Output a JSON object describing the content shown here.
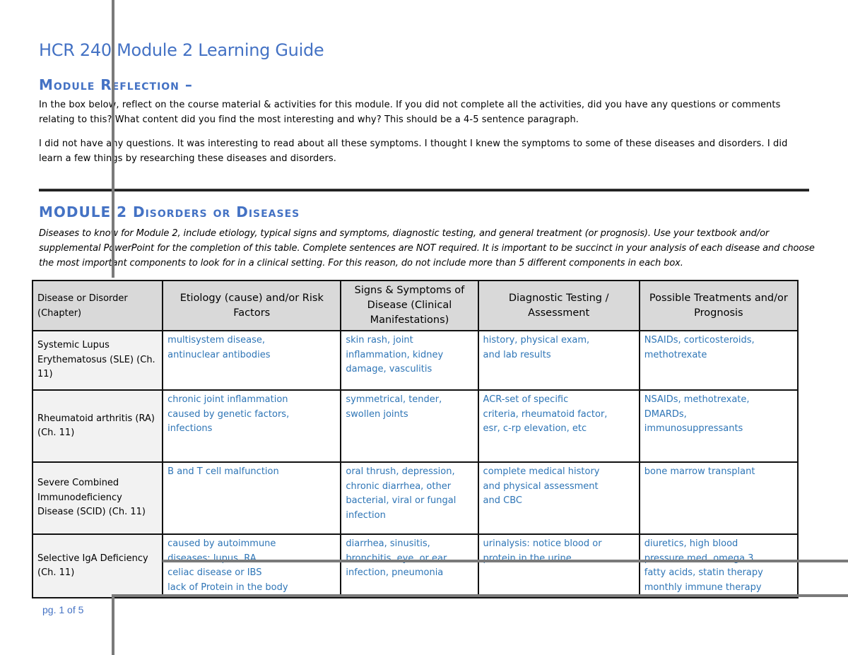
{
  "document": {
    "title": "HCR 240 Module 2 Learning Guide",
    "reflection": {
      "heading": "Module Reflection –",
      "prompt": "In the box below, reflect on the course material & activities for this module.  If you did not complete all the activities, did you have any questions or comments relating to this?  What content did you find the most interesting and why?  This should be a 4-5 sentence paragraph.",
      "answer": "I did not have any questions. It was interesting to read about all these symptoms. I thought I knew the symptoms to some of these diseases and disorders. I did learn a few things by researching these diseases and disorders."
    },
    "module": {
      "heading": "MODULE 2 Disorders or Diseases",
      "instructions": "Diseases to know for Module 2, include etiology, typical signs and symptoms, diagnostic testing, and general treatment (or prognosis).  Use your textbook and/or supplemental PowerPoint for the completion of this table.  Complete sentences are NOT required.   It is important to be succinct in your analysis of each disease and choose the most important components to look for in a clinical setting. For this reason, do not include more than 5 different components in each box."
    },
    "table": {
      "headers": [
        "Disease or Disorder (Chapter)",
        "Etiology (cause) and/or Risk Factors",
        "Signs & Symptoms of Disease (Clinical Manifestations)",
        "Diagnostic Testing / Assessment",
        "Possible Treatments and/or Prognosis"
      ],
      "rows": [
        {
          "disease": "Systemic Lupus Erythematosus (SLE) (Ch. 11)",
          "etiology": "multisystem disease,\nantinuclear antibodies",
          "symptoms": "skin rash, joint\ninflammation, kidney\ndamage, vasculitis",
          "diagnostic": "history, physical exam,\nand lab results",
          "treatment": "NSAIDs, corticosteroids,\nmethotrexate"
        },
        {
          "disease": "Rheumatoid arthritis (RA) (Ch. 11)",
          "etiology": "chronic joint inflammation\ncaused by genetic factors,\ninfections",
          "symptoms": "symmetrical, tender,\nswollen joints",
          "diagnostic": "ACR-set of specific\ncriteria, rheumatoid factor,\nesr, c-rp elevation, etc",
          "treatment": "NSAIDs, methotrexate,\nDMARDs,\nimmunosuppressants"
        },
        {
          "disease": "Severe Combined Immunodeficiency Disease (SCID) (Ch. 11)",
          "etiology": "B and T cell malfunction",
          "symptoms": "oral thrush, depression,\nchronic diarrhea, other\nbacterial, viral or fungal\ninfection",
          "diagnostic": "complete medical history\nand physical assessment\nand CBC",
          "treatment": "bone marrow transplant"
        },
        {
          "disease": "Selective IgA Deficiency (Ch. 11)",
          "etiology": "caused by autoimmune\ndiseases: lupus, RA,\nceliac disease or IBS\nlack of Protein in the body",
          "symptoms": "diarrhea, sinusitis,\nbronchitis, eye, or ear\ninfection, pneumonia",
          "diagnostic": "urinalysis: notice blood or\nprotein in the urine",
          "treatment": "diuretics, high blood\npressure med, omega 3\nfatty acids, statin therapy\nmonthly immune therapy"
        }
      ]
    },
    "footer": {
      "page_label": "pg. 1 of 5"
    }
  },
  "colors": {
    "heading_blue": "#4472c4",
    "answer_blue": "#2e75b6",
    "header_gray": "#d9d9d9",
    "overlay_line_gray": "#7a7a7a"
  }
}
